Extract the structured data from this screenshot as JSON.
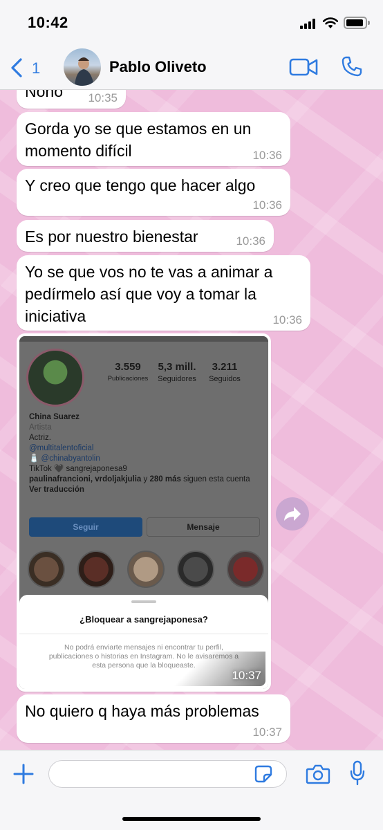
{
  "status_bar": {
    "time": "10:42"
  },
  "header": {
    "back_count": "1",
    "contact_name": "Pablo Oliveto"
  },
  "messages": [
    {
      "text": "Noño",
      "time": "10:35"
    },
    {
      "text": "Gorda yo se que estamos en un momento difícil",
      "time": "10:36"
    },
    {
      "text": "Y creo que tengo que hacer algo",
      "time": "10:36"
    },
    {
      "text": "Es por nuestro bienestar",
      "time": "10:36"
    },
    {
      "text": "Yo se que vos no te vas a animar a pedírmelo así que voy a tomar la iniciativa",
      "time": "10:36"
    },
    {
      "text": "No quiero q haya más problemas",
      "time": "10:37"
    }
  ],
  "image_message": {
    "time": "10:37",
    "profile": {
      "stats": [
        {
          "value": "3.559",
          "label": "Publicaciones"
        },
        {
          "value": "5,3 mill.",
          "label": "Seguidores"
        },
        {
          "value": "3.211",
          "label": "Seguidos"
        }
      ],
      "name": "China Suarez",
      "category": "Artista",
      "bio_line": "Actriz.",
      "link1": "@multitalentoficial",
      "link2": "🧂 @chinabyantolin",
      "tiktok_line": "TikTok 🖤 sangrejaponesa9",
      "followed_by_names": "paulinafrancioni, vrdoljakjulia",
      "followed_by_connector": " y ",
      "followed_by_more": "280 más",
      "followed_by_suffix": " siguen esta cuenta",
      "translate": "Ver traducción",
      "follow_button": "Seguir",
      "message_button": "Mensaje"
    },
    "block_sheet": {
      "title": "¿Bloquear a sangrejaponesa?",
      "body": "No podrá enviarte mensajes ni encontrar tu perfil, publicaciones o historias en Instagram. No le avisaremos a esta persona que la bloqueaste."
    }
  },
  "input": {
    "placeholder": ""
  },
  "colors": {
    "chat_background": "#efbcdc",
    "accent": "#2f7be0",
    "bubble": "#ffffff",
    "timestamp": "#9a9a9a"
  }
}
